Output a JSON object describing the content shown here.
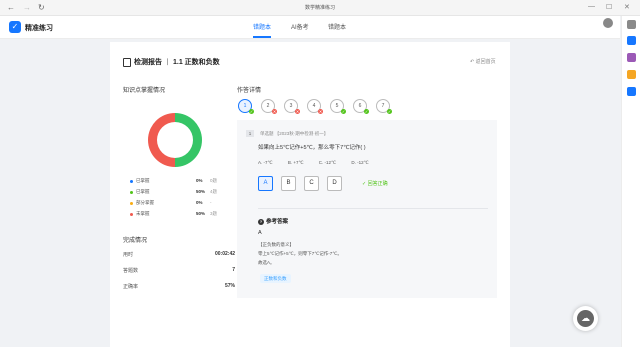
{
  "window": {
    "title": "数学精准练习",
    "nav_back": "←",
    "nav_forward": "→",
    "nav_reload": "↻",
    "btn_min": "—",
    "btn_max": "☐",
    "btn_close": "✕"
  },
  "app": {
    "logo_glyph": "✓",
    "name": "精准练习"
  },
  "tabs": [
    {
      "label": "错题本"
    },
    {
      "label": "AI备考"
    },
    {
      "label": "错题本"
    }
  ],
  "report": {
    "title": "检测报告",
    "separator": "丨",
    "subtitle": "1.1 正数和负数",
    "back_label": "返回首页"
  },
  "score_section": {
    "title": "知识点掌握情况",
    "legend": [
      {
        "label": "已掌握",
        "pct": "0%",
        "count": "0题",
        "color": "#1677ff"
      },
      {
        "label": "已掌握",
        "pct": "50%",
        "count": "4题",
        "color": "#52c41a"
      },
      {
        "label": "部分掌握",
        "pct": "0%",
        "count": "-",
        "color": "#faad14"
      },
      {
        "label": "未掌握",
        "pct": "50%",
        "count": "3题",
        "color": "#f05a4f"
      }
    ]
  },
  "stats": {
    "title": "完成情况",
    "rows": [
      {
        "label": "用时",
        "value": "00:02:42"
      },
      {
        "label": "答题数",
        "value": "7"
      },
      {
        "label": "正确率",
        "value": "57%"
      }
    ]
  },
  "answers": {
    "title": "作答详情",
    "items": [
      {
        "num": "1",
        "status": "correct"
      },
      {
        "num": "2",
        "status": "wrong"
      },
      {
        "num": "3",
        "status": "wrong"
      },
      {
        "num": "4",
        "status": "wrong"
      },
      {
        "num": "5",
        "status": "correct"
      },
      {
        "num": "6",
        "status": "correct"
      },
      {
        "num": "7",
        "status": "correct"
      }
    ],
    "correct_mark": "✓",
    "wrong_mark": "✕"
  },
  "question": {
    "index": "1",
    "source": "单选题 【2023秋·期中检测·初一】",
    "stem": "如果向上5℃记作+5℃，那么零下7℃记作( )",
    "options_text": [
      "A. -7℃",
      "B. +7℃",
      "C. -12℃",
      "D. -12℃"
    ],
    "option_letters": [
      "A",
      "B",
      "C",
      "D"
    ],
    "selected": "A",
    "result": "✓ 回答正确"
  },
  "reference": {
    "title": "参考答案",
    "answer": "A",
    "lines": [
      "【正负数的意义】",
      "零上5℃记作+5℃，则零下7℃记作-7℃。",
      "故选A。"
    ],
    "knowledge_point": "正数和负数"
  },
  "fab_icon": "☁"
}
